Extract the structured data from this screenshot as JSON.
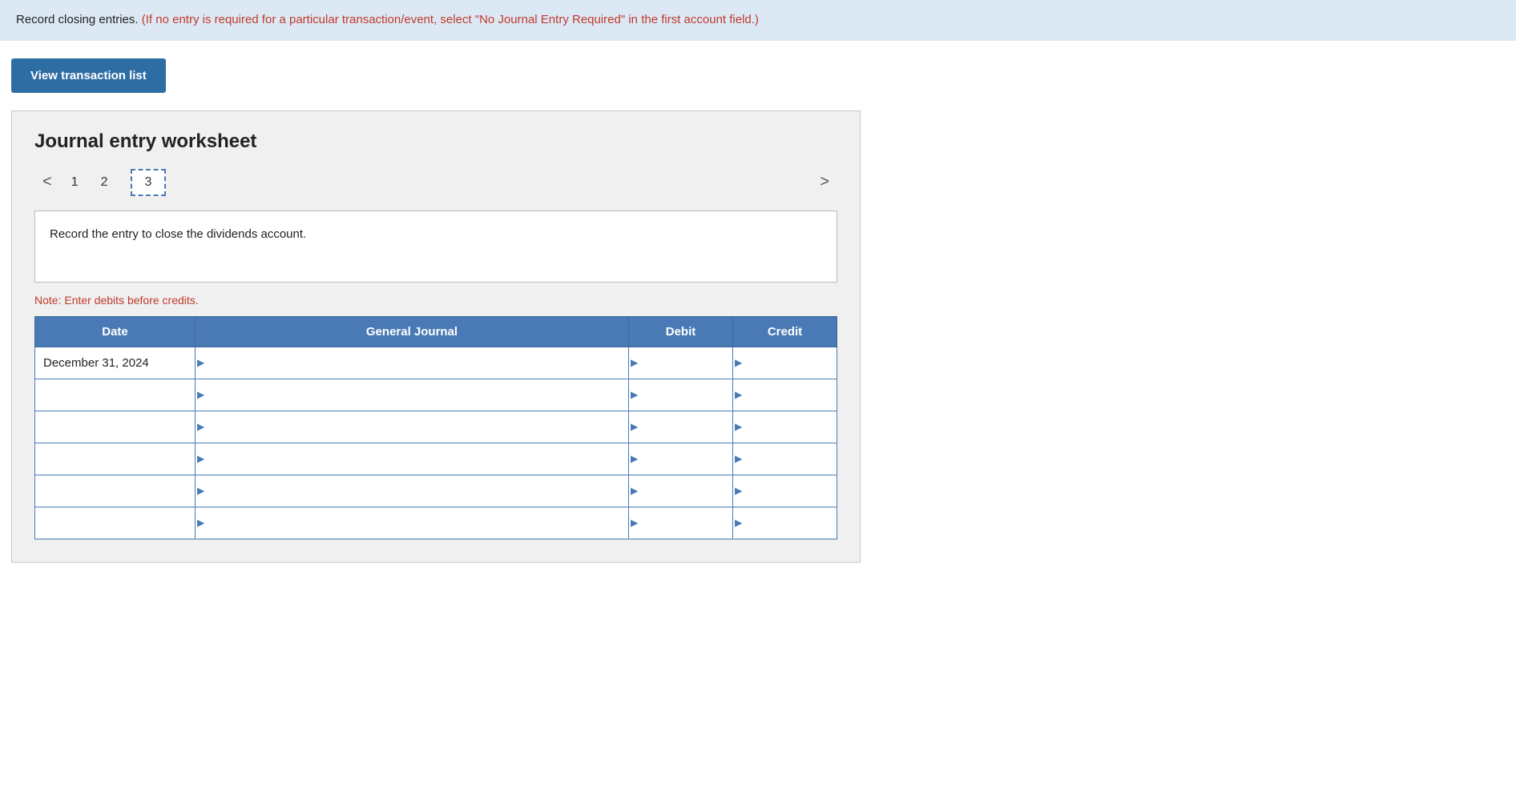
{
  "instruction": {
    "text": "Record closing entries.",
    "red_text": " (If no entry is required for a particular transaction/event, select \"No Journal Entry Required\" in the first account field.)"
  },
  "buttons": {
    "view_transaction_list": "View transaction list"
  },
  "worksheet": {
    "title": "Journal entry worksheet",
    "pages": [
      {
        "label": "1",
        "active": false
      },
      {
        "label": "2",
        "active": false
      },
      {
        "label": "3",
        "active": true
      }
    ],
    "nav_left": "<",
    "nav_right": ">",
    "description": "Record the entry to close the dividends account.",
    "note": "Note: Enter debits before credits.",
    "table": {
      "headers": {
        "date": "Date",
        "general_journal": "General Journal",
        "debit": "Debit",
        "credit": "Credit"
      },
      "rows": [
        {
          "date": "December 31, 2024",
          "general_journal": "",
          "debit": "",
          "credit": ""
        },
        {
          "date": "",
          "general_journal": "",
          "debit": "",
          "credit": ""
        },
        {
          "date": "",
          "general_journal": "",
          "debit": "",
          "credit": ""
        },
        {
          "date": "",
          "general_journal": "",
          "debit": "",
          "credit": ""
        },
        {
          "date": "",
          "general_journal": "",
          "debit": "",
          "credit": ""
        },
        {
          "date": "",
          "general_journal": "",
          "debit": "",
          "credit": ""
        }
      ]
    }
  }
}
